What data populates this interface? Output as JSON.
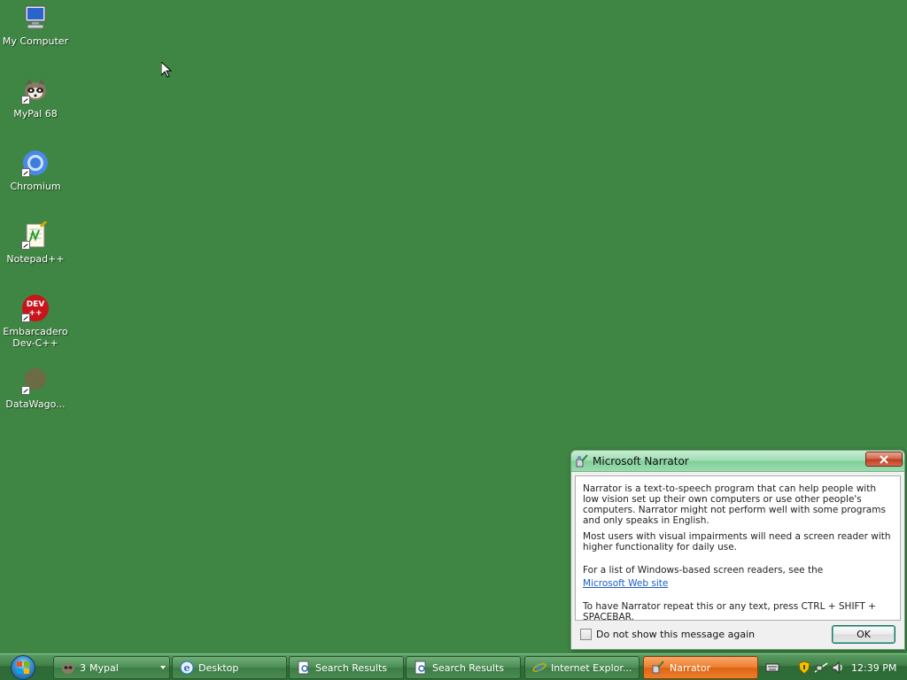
{
  "desktop": {
    "icons": [
      {
        "label": "My Computer"
      },
      {
        "label": "MyPal 68"
      },
      {
        "label": "Chromium"
      },
      {
        "label": "Notepad++"
      },
      {
        "label": "Embarcadero Dev-C++"
      },
      {
        "label": "DataWago..."
      }
    ]
  },
  "dialog": {
    "title": "Microsoft Narrator",
    "para1": "Narrator is a text-to-speech program that can help people with low vision set up their own computers or use other people's computers. Narrator might not perform well with some programs and only speaks in English.",
    "para2": "Most users with visual impairments will need a screen reader with higher functionality for daily use.",
    "para3": "For a list of Windows-based screen readers, see the",
    "link": "Microsoft Web site",
    "para4": "To have Narrator repeat this or any text, press CTRL + SHIFT + SPACEBAR.",
    "checkbox_label": "Do not show this message again",
    "ok_label": "OK"
  },
  "taskbar": {
    "buttons": [
      {
        "count": "3",
        "label": "Mypal"
      },
      {
        "label": "Desktop"
      },
      {
        "label": "Search Results"
      },
      {
        "label": "Search Results"
      },
      {
        "label": "Internet Explor..."
      },
      {
        "label": "Narrator"
      }
    ],
    "clock": "12:39 PM"
  },
  "colors": {
    "desktop_bg": "#3f8543",
    "taskbar_active": "#ec7d2e",
    "link": "#1a5ec6"
  }
}
